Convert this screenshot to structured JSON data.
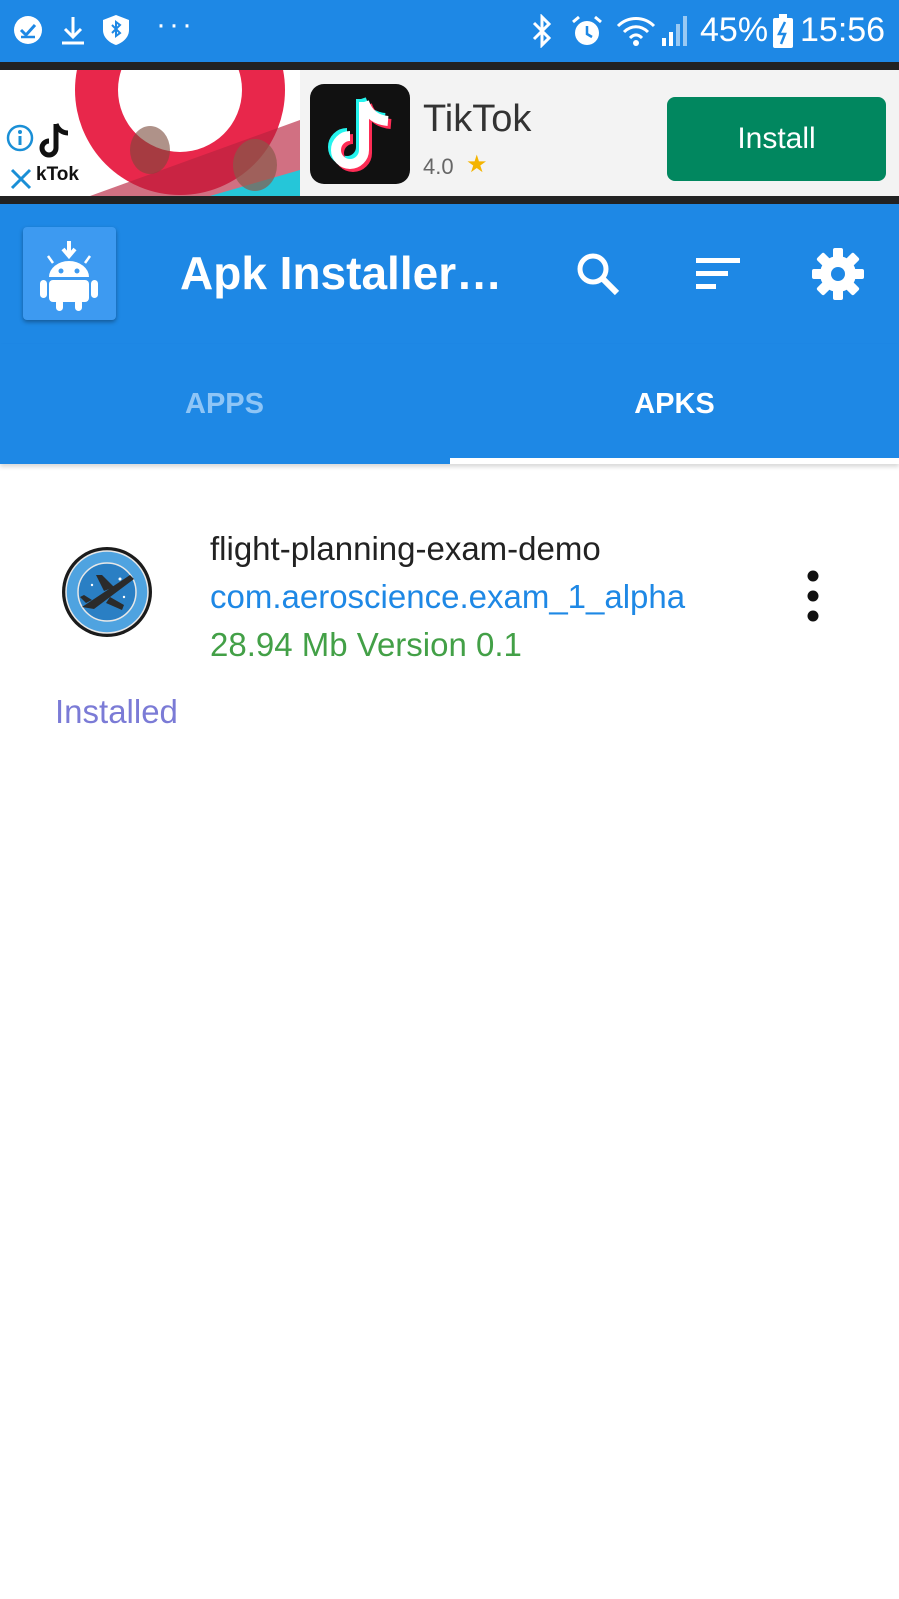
{
  "status_bar": {
    "battery": "45%",
    "time": "15:56",
    "icons": [
      "check-circle-icon",
      "download-icon",
      "shield-icon",
      "more-dots-icon",
      "bluetooth-icon",
      "alarm-icon",
      "wifi-icon",
      "signal-icon",
      "battery-icon"
    ]
  },
  "ad": {
    "image_text": "kTok",
    "app_name": "TikTok",
    "rating": "4.0",
    "install_label": "Install",
    "icons": [
      "info-icon",
      "close-icon",
      "star-icon"
    ]
  },
  "app_bar": {
    "title": "Apk Installer…",
    "icons": [
      "android-download-icon",
      "search-icon",
      "sort-icon",
      "settings-icon"
    ]
  },
  "tabs": [
    {
      "label": "APPS",
      "selected": false
    },
    {
      "label": "APKS",
      "selected": true
    }
  ],
  "apks": [
    {
      "name": "flight-planning-exam-demo",
      "package": "com.aeroscience.exam_1_alpha",
      "meta": "28.94 Mb Version 0.1",
      "status": "Installed"
    }
  ],
  "colors": {
    "primary": "#1e88e5",
    "install_green": "#01875f",
    "size_green": "#43a047",
    "installed_purple": "#7b7bd6"
  }
}
